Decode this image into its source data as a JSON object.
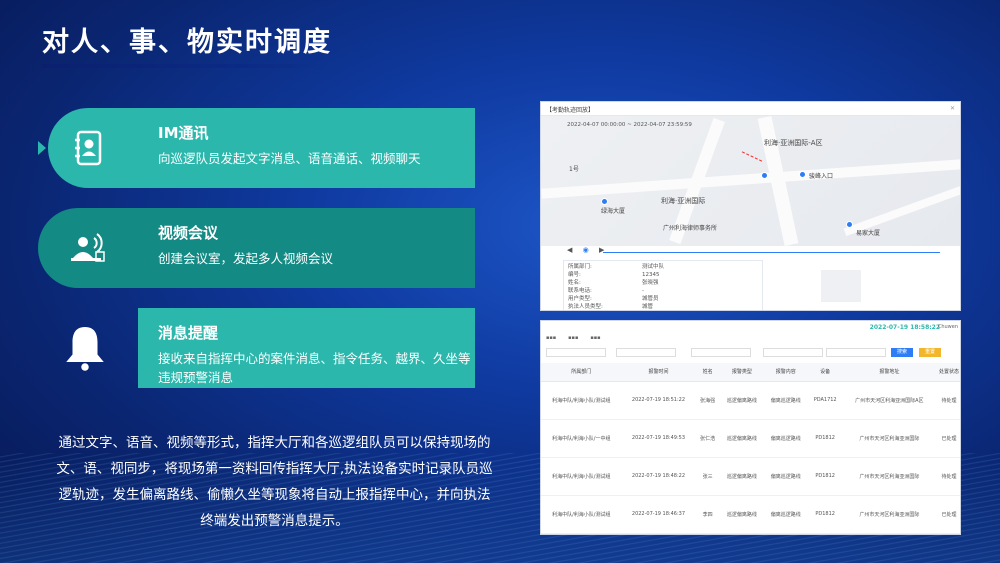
{
  "title": "对人、事、物实时调度",
  "features": [
    {
      "heading": "IM通讯",
      "desc": "向巡逻队员发起文字消息、语音通话、视频聊天",
      "icon": "contact-book-icon"
    },
    {
      "heading": "视频会议",
      "desc": "创建会议室，发起多人视频会议",
      "icon": "video-conference-icon"
    },
    {
      "heading": "消息提醒",
      "desc": "接收来自指挥中心的案件消息、指令任务、越界、久坐等违规预警消息",
      "icon": "bell-icon"
    }
  ],
  "paragraph": "通过文字、语音、视频等形式，指挥大厅和各巡逻组队员可以保持现场的文、语、视同步，将现场第一资料回传指挥大厅,执法设备实时记录队员巡逻轨迹，发生偏离路线、偷懒久坐等现象将自动上报指挥中心，并向执法终端发出预警消息提示。",
  "colors": {
    "accent": "#2cb7ac",
    "accent_dark": "#138a84",
    "bg": "#0f3aa0"
  },
  "screenshot1": {
    "header": "【考勤轨迹回放】",
    "date_range": "2022-04-07 00:00:00  ~  2022-04-07 23:59:59",
    "map_labels": [
      "利海·亚洲国际-A区",
      "利海·亚洲国际",
      "1号",
      "绿海大厦",
      "广州利海律师事务所",
      "骏峰入口",
      "易家大厦"
    ],
    "info_rows": [
      {
        "k": "所属部门:",
        "v": "测试中队"
      },
      {
        "k": "编号:",
        "v": "12345"
      },
      {
        "k": "姓名:",
        "v": "张晓强"
      },
      {
        "k": "联系电话:",
        "v": "-"
      },
      {
        "k": "用户类型:",
        "v": "城管员"
      },
      {
        "k": "执法人员类型:",
        "v": "城管"
      }
    ]
  },
  "screenshot2": {
    "time": "2022-07-19 18:58:22",
    "user": "Chuwen",
    "search_btn": "搜索",
    "reset_btn": "重置",
    "columns": [
      "所属部门",
      "报警时间",
      "姓名",
      "报警类型",
      "报警内容",
      "设备",
      "报警地址",
      "处置状态"
    ],
    "rows": [
      [
        "利海中队/利海小队/测试组",
        "2022-07-19 18:51:22",
        "张海强",
        "巡逻偏离路线",
        "偏离巡逻路线",
        "PDA1712",
        "广州市天河区利海亚洲国际A区",
        "待处理"
      ],
      [
        "利海中队/利海小队/一中组",
        "2022-07-19 18:49:53",
        "张仁浩",
        "巡逻偏离路线",
        "偏离巡逻路线",
        "PD1812",
        "广州市天河区利海亚洲国际",
        "已处理"
      ],
      [
        "利海中队/利海小队/测试组",
        "2022-07-19 18:48:22",
        "张三",
        "巡逻偏离路线",
        "偏离巡逻路线",
        "PD1812",
        "广州市天河区利海亚洲国际",
        "待处理"
      ],
      [
        "利海中队/利海小队/测试组",
        "2022-07-19 18:46:37",
        "李四",
        "巡逻偏离路线",
        "偏离巡逻路线",
        "PD1812",
        "广州市天河区利海亚洲国际",
        "已处理"
      ]
    ]
  }
}
